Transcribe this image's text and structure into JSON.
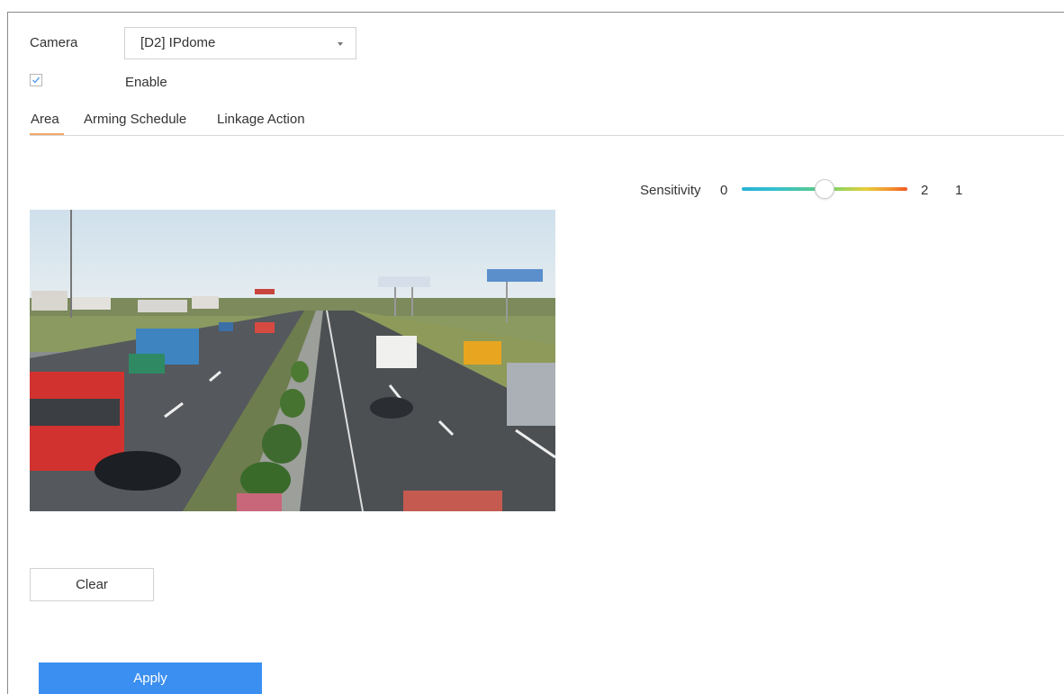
{
  "camera": {
    "label": "Camera",
    "selected": "[D2] IPdome",
    "caret_icon": "caret-down-icon"
  },
  "enable": {
    "label": "Enable",
    "checked": true,
    "icon": "check-icon"
  },
  "tabs": [
    {
      "label": "Area",
      "active": true
    },
    {
      "label": "Arming Schedule",
      "active": false
    },
    {
      "label": "Linkage Action",
      "active": false
    }
  ],
  "sensitivity": {
    "label": "Sensitivity",
    "min_label": "0",
    "max_label": "2",
    "value": "1",
    "level_fraction": 0.5
  },
  "buttons": {
    "clear": "Clear",
    "apply": "Apply"
  },
  "colors": {
    "accent": "#3b8ff0",
    "tab_underline": "#f0a868"
  }
}
